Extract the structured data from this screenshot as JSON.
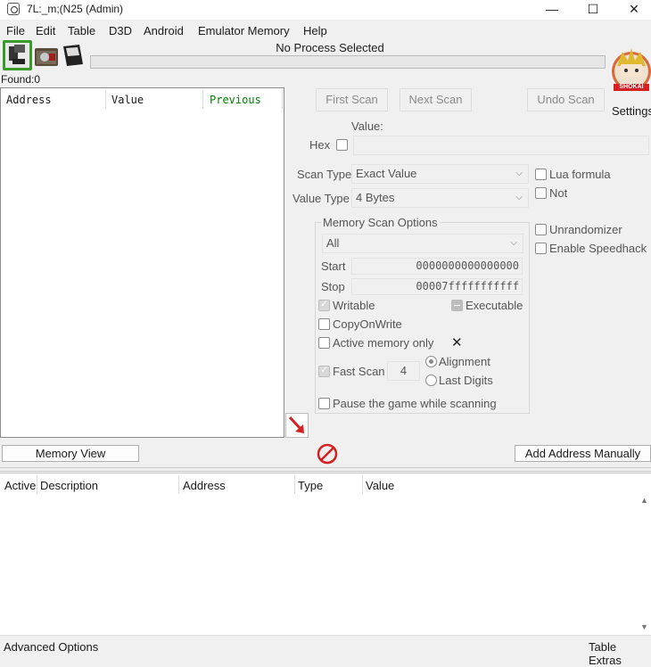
{
  "window": {
    "title": "7L:_m;(N25 (Admin)",
    "minimize_glyph": "—",
    "maximize_glyph": "☐",
    "close_glyph": "✕"
  },
  "menu": [
    "File",
    "Edit",
    "Table",
    "D3D",
    "Android",
    "Emulator Memory",
    "Help"
  ],
  "toolbar": {
    "process_label": "No Process Selected",
    "found_label": "Found:0",
    "settings_label": "Settings",
    "avatar_text": "SHOKAI"
  },
  "results": {
    "columns": [
      "Address",
      "Value",
      "Previous"
    ],
    "previous_color": "#008000"
  },
  "scan": {
    "first_scan": "First Scan",
    "next_scan": "Next Scan",
    "undo_scan": "Undo Scan",
    "value_label": "Value:",
    "hex_label": "Hex",
    "value_input": "",
    "scan_type_label": "Scan Type",
    "scan_type_value": "Exact Value",
    "value_type_label": "Value Type",
    "value_type_value": "4 Bytes",
    "lua_formula": "Lua formula",
    "not_label": "Not",
    "unrandomizer": "Unrandomizer",
    "enable_speedhack": "Enable Speedhack"
  },
  "memory_options": {
    "title": "Memory Scan Options",
    "region": "All",
    "start_label": "Start",
    "start_value": "0000000000000000",
    "stop_label": "Stop",
    "stop_value": "00007fffffffffff",
    "writable": "Writable",
    "executable": "Executable",
    "copy_on_write": "CopyOnWrite",
    "active_memory_only": "Active memory only",
    "fast_scan": "Fast Scan",
    "fast_scan_value": "4",
    "alignment": "Alignment",
    "last_digits": "Last Digits",
    "pause_game": "Pause the game while scanning"
  },
  "actions": {
    "memory_view": "Memory View",
    "add_address_manually": "Add Address Manually"
  },
  "address_table": {
    "columns": [
      "Active",
      "Description",
      "Address",
      "Type",
      "Value"
    ]
  },
  "status": {
    "advanced_options": "Advanced Options",
    "table_extras": "Table Extras"
  },
  "colors": {
    "accent_green": "#3a9a2a",
    "arrow_red": "#d42020",
    "stop_red": "#d42020"
  }
}
